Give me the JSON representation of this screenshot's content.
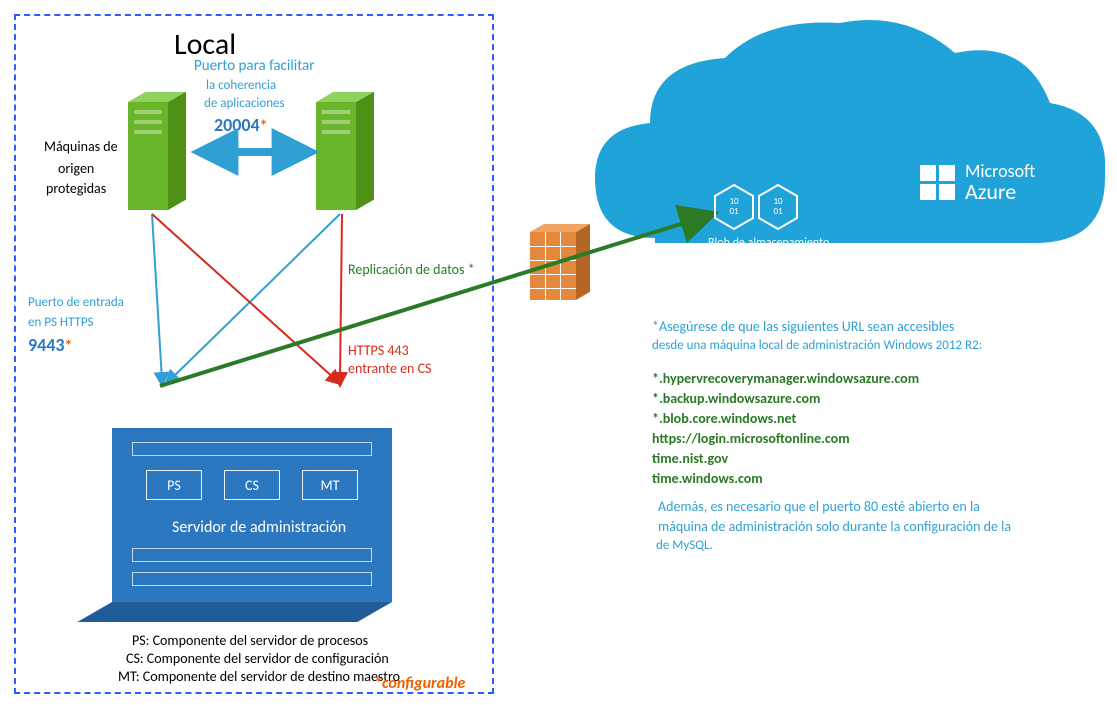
{
  "local": {
    "title": "Local",
    "source_label_1": "Máquinas de",
    "source_label_2": "origen",
    "source_label_3": "protegidas",
    "app_port_label_1": "Puerto para facilitar",
    "app_port_label_2": "la coherencia",
    "app_port_label_3": "de aplicaciones",
    "app_port_num": "20004",
    "inbound_ps_1": "Puerto de entrada",
    "inbound_ps_2": "en PS HTTPS",
    "inbound_ps_port": "9443",
    "https_cs_1": "HTTPS 443",
    "https_cs_2": "entrante en CS",
    "mgmt": {
      "ps": "PS",
      "cs": "CS",
      "mt": "MT",
      "label": "Servidor de administración"
    },
    "legend": {
      "ps": "PS: Componente del servidor de procesos",
      "cs": "CS: Componente del servidor de configuración",
      "mt": "MT: Componente del servidor de destino maestro"
    },
    "configurable": "*configurable"
  },
  "replication_label": "Replicación de datos *",
  "azure": {
    "blob_label": "Blob de almacenamiento",
    "brand_1": "Microsoft",
    "brand_2": "Azure"
  },
  "notes": {
    "intro_1": "*Asegúrese de que las siguientes URL sean accesibles",
    "intro_2": "desde una máquina local de administración Windows 2012 R2:",
    "urls": [
      "*.hypervrecoverymanager.windowsazure.com",
      "*.backup.windowsazure.com",
      "*.blob.core.windows.net",
      "https://login.microsoftonline.com",
      "time.nist.gov",
      "time.windows.com"
    ],
    "extra_1": "Además, es necesario que el puerto 80 esté abierto en la",
    "extra_2": "máquina de administración solo durante la configuración de la",
    "extra_3": "de MySQL."
  },
  "star": "*"
}
